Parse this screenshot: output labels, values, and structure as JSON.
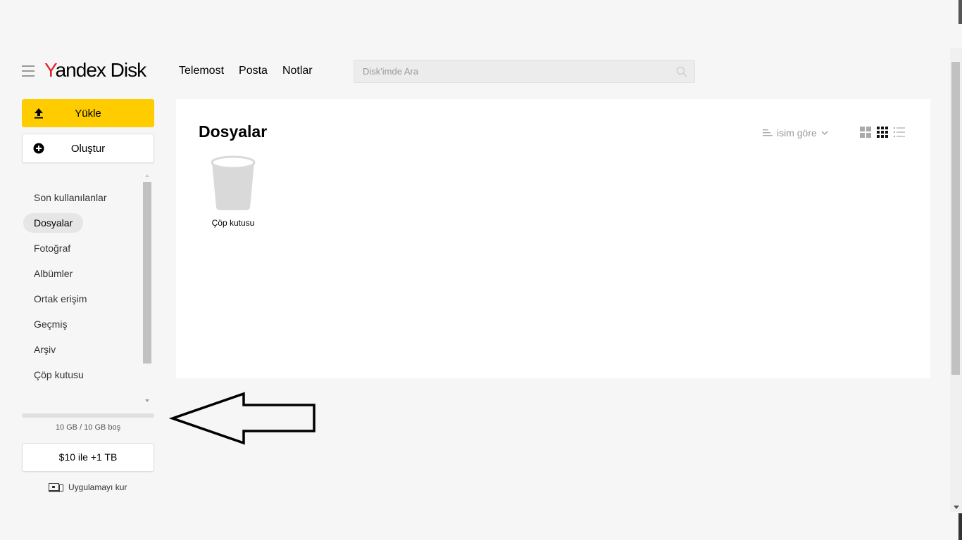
{
  "header": {
    "logo_y": "Y",
    "logo_rest": "andex Disk",
    "nav": [
      "Telemost",
      "Posta",
      "Notlar"
    ],
    "search_placeholder": "Disk'imde Ara"
  },
  "sidebar": {
    "upload_label": "Yükle",
    "create_label": "Oluştur",
    "items": [
      {
        "label": "Son kullanılanlar",
        "active": false
      },
      {
        "label": "Dosyalar",
        "active": true
      },
      {
        "label": "Fotoğraf",
        "active": false
      },
      {
        "label": "Albümler",
        "active": false
      },
      {
        "label": "Ortak erişim",
        "active": false
      },
      {
        "label": "Geçmiş",
        "active": false
      },
      {
        "label": "Arşiv",
        "active": false
      },
      {
        "label": "Çöp kutusu",
        "active": false
      }
    ],
    "storage_text": "10 GB / 10 GB boş",
    "storage_used_fraction": 0.0,
    "buy_label": "$10 ile +1 TB",
    "install_app_label": "Uygulamayı kur"
  },
  "main": {
    "title": "Dosyalar",
    "sort_label": "isim göre",
    "view_modes": [
      "large-grid-icon",
      "small-grid-icon",
      "list-icon"
    ],
    "active_view": "small-grid-icon",
    "files": [
      {
        "name": "Çöp kutusu",
        "icon": "trash-bin-icon"
      }
    ]
  },
  "colors": {
    "accent_yellow": "#ffcc00",
    "logo_red": "#e0232b",
    "background": "#f6f6f6"
  }
}
